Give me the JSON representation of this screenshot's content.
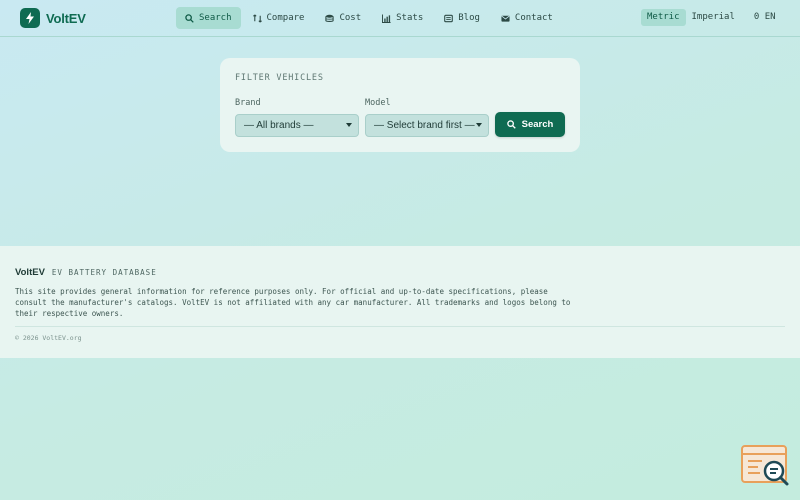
{
  "app": {
    "name": "VoltEV"
  },
  "nav": [
    {
      "label": "Search",
      "icon": "search-icon",
      "active": true
    },
    {
      "label": "Compare",
      "icon": "compare-icon",
      "active": false
    },
    {
      "label": "Cost",
      "icon": "cost-icon",
      "active": false
    },
    {
      "label": "Stats",
      "icon": "stats-icon",
      "active": false
    },
    {
      "label": "Blog",
      "icon": "blog-icon",
      "active": false
    },
    {
      "label": "Contact",
      "icon": "mail-icon",
      "active": false
    }
  ],
  "units": {
    "metric": "Metric",
    "imperial": "Imperial",
    "selected": "Metric"
  },
  "language": {
    "label": "0 EN"
  },
  "filter": {
    "title": "FILTER VEHICLES",
    "brand_label": "Brand",
    "brand_value": "— All brands —",
    "model_label": "Model",
    "model_value": "— Select brand first —",
    "search_label": "Search"
  },
  "footer": {
    "logo": "VoltEV",
    "tagline": "EV BATTERY DATABASE",
    "disclaimer": "This site provides general information for reference purposes only. For official and up-to-date specifications, please consult the manufacturer's catalogs. VoltEV is not affiliated with any car manufacturer. All trademarks and logos belong to their respective owners.",
    "copyright": "© 2026 VoltEV.org"
  },
  "colors": {
    "accent": "#0f6b52",
    "active_tab": "#a8dcd2",
    "widget_orange": "#e8a05a"
  }
}
